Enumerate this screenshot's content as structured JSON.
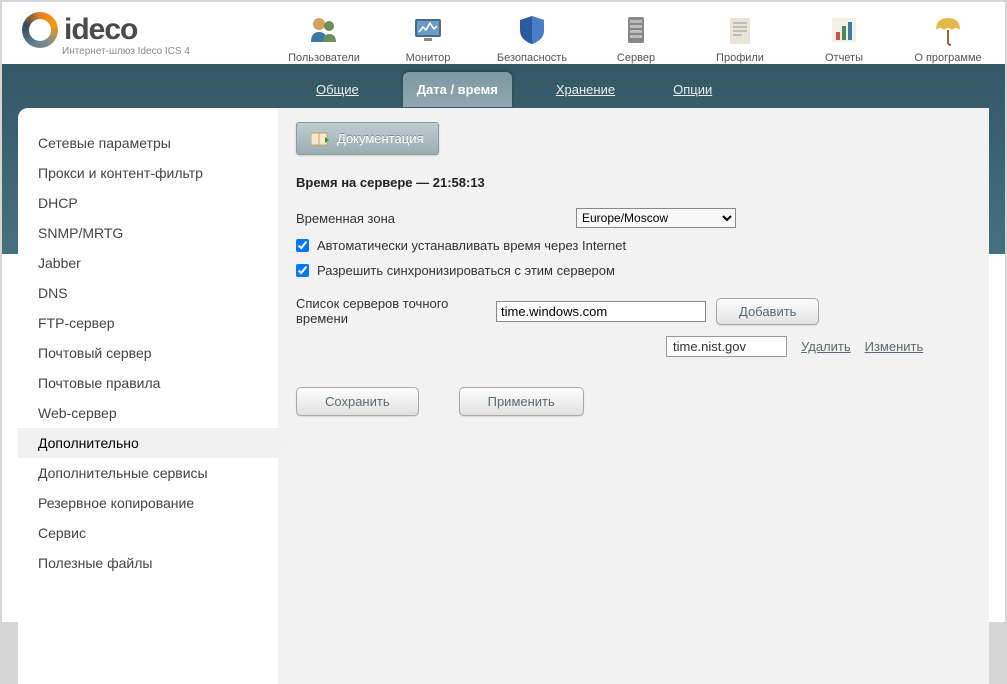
{
  "logo": {
    "text": "ideco",
    "subtitle": "Интернет-шлюз Ideco ICS 4"
  },
  "topnav": [
    {
      "label": "Пользователи"
    },
    {
      "label": "Монитор"
    },
    {
      "label": "Безопасность"
    },
    {
      "label": "Сервер"
    },
    {
      "label": "Профили"
    },
    {
      "label": "Отчеты"
    },
    {
      "label": "О программе"
    }
  ],
  "subtabs": [
    {
      "label": "Общие"
    },
    {
      "label": "Дата / время"
    },
    {
      "label": "Хранение"
    },
    {
      "label": "Опции"
    }
  ],
  "sidebar": [
    "Сетевые параметры",
    "Прокси и контент-фильтр",
    "DHCP",
    "SNMP/MRTG",
    "Jabber",
    "DNS",
    "FTP-сервер",
    "Почтовый сервер",
    "Почтовые правила",
    "Web-сервер",
    "Дополнительно",
    "Дополнительные сервисы",
    "Резервное копирование",
    "Сервис",
    "Полезные файлы"
  ],
  "content": {
    "doc_button": "Документация",
    "section_title": "Время на сервере — 21:58:13",
    "timezone_label": "Временная зона",
    "timezone_value": "Europe/Moscow",
    "auto_sync_label": "Автоматически устанавливать время через Internet",
    "allow_sync_label": "Разрешить синхронизироваться с этим сервером",
    "servers_list_label": "Список серверов точного времени",
    "server_input_value": "time.windows.com",
    "add_button": "Добавить",
    "existing_server": "time.nist.gov",
    "delete_link": "Удалить",
    "edit_link": "Изменить",
    "save_button": "Сохранить",
    "apply_button": "Применить"
  }
}
